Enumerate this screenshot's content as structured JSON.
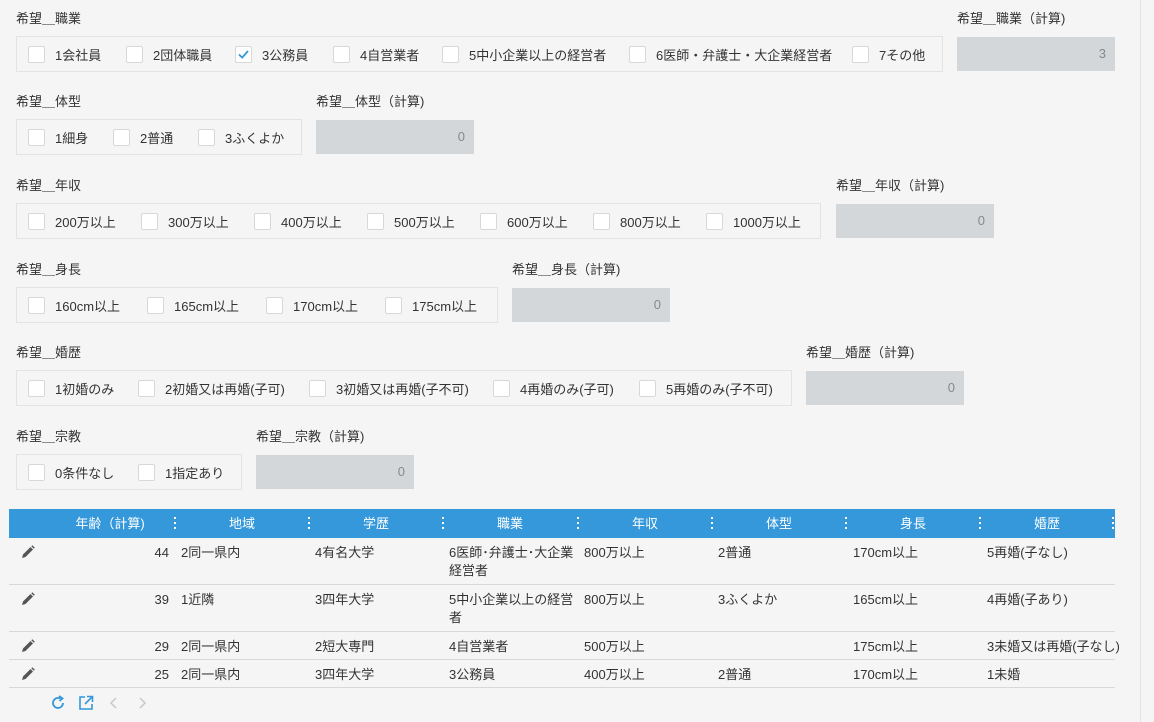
{
  "fields": {
    "occupation": {
      "label": "希望＿職業",
      "options": [
        {
          "label": "1会社員",
          "checked": false
        },
        {
          "label": "2団体職員",
          "checked": false
        },
        {
          "label": "3公務員",
          "checked": true
        },
        {
          "label": "4自営業者",
          "checked": false
        },
        {
          "label": "5中小企業以上の経営者",
          "checked": false
        },
        {
          "label": "6医師・弁護士・大企業経営者",
          "checked": false
        },
        {
          "label": "7その他",
          "checked": false
        }
      ],
      "calc_label": "希望＿職業（計算)",
      "calc_value": "3"
    },
    "body_type": {
      "label": "希望＿体型",
      "options": [
        {
          "label": "1細身",
          "checked": false
        },
        {
          "label": "2普通",
          "checked": false
        },
        {
          "label": "3ふくよか",
          "checked": false
        }
      ],
      "calc_label": "希望＿体型（計算)",
      "calc_value": "0"
    },
    "income": {
      "label": "希望＿年収",
      "options": [
        {
          "label": "200万以上",
          "checked": false
        },
        {
          "label": "300万以上",
          "checked": false
        },
        {
          "label": "400万以上",
          "checked": false
        },
        {
          "label": "500万以上",
          "checked": false
        },
        {
          "label": "600万以上",
          "checked": false
        },
        {
          "label": "800万以上",
          "checked": false
        },
        {
          "label": "1000万以上",
          "checked": false
        }
      ],
      "calc_label": "希望＿年収（計算)",
      "calc_value": "0"
    },
    "height": {
      "label": "希望＿身長",
      "options": [
        {
          "label": "160cm以上",
          "checked": false
        },
        {
          "label": "165cm以上",
          "checked": false
        },
        {
          "label": "170cm以上",
          "checked": false
        },
        {
          "label": "175cm以上",
          "checked": false
        }
      ],
      "calc_label": "希望＿身長（計算)",
      "calc_value": "0"
    },
    "marital": {
      "label": "希望＿婚歴",
      "options": [
        {
          "label": "1初婚のみ",
          "checked": false
        },
        {
          "label": "2初婚又は再婚(子可)",
          "checked": false
        },
        {
          "label": "3初婚又は再婚(子不可)",
          "checked": false
        },
        {
          "label": "4再婚のみ(子可)",
          "checked": false
        },
        {
          "label": "5再婚のみ(子不可)",
          "checked": false
        }
      ],
      "calc_label": "希望＿婚歴（計算)",
      "calc_value": "0"
    },
    "religion": {
      "label": "希望＿宗教",
      "options": [
        {
          "label": "0条件なし",
          "checked": false
        },
        {
          "label": "1指定あり",
          "checked": false
        }
      ],
      "calc_label": "希望＿宗教（計算)",
      "calc_value": "0"
    }
  },
  "table": {
    "columns": [
      "年齢（計算)",
      "地域",
      "学歴",
      "職業",
      "年収",
      "体型",
      "身長",
      "婚歴"
    ],
    "rows": [
      {
        "age": "44",
        "region": "2同一県内",
        "education": "4有名大学",
        "occupation": "6医師･弁護士･大企業経営者",
        "income": "800万以上",
        "body": "2普通",
        "height": "170cm以上",
        "marital": "5再婚(子なし)"
      },
      {
        "age": "39",
        "region": "1近隣",
        "education": "3四年大学",
        "occupation": "5中小企業以上の経営者",
        "income": "800万以上",
        "body": "3ふくよか",
        "height": "165cm以上",
        "marital": "4再婚(子あり)"
      },
      {
        "age": "29",
        "region": "2同一県内",
        "education": "2短大専門",
        "occupation": "4自営業者",
        "income": "500万以上",
        "body": "",
        "height": "175cm以上",
        "marital": "3未婚又は再婚(子なし)"
      },
      {
        "age": "25",
        "region": "2同一県内",
        "education": "3四年大学",
        "occupation": "3公務員",
        "income": "400万以上",
        "body": "2普通",
        "height": "170cm以上",
        "marital": "1未婚"
      }
    ]
  },
  "icons": {
    "edit": "pencil-icon",
    "refresh": "refresh-icon",
    "open": "open-external-icon",
    "prev": "chevron-left-icon",
    "next": "chevron-right-icon"
  },
  "colors": {
    "header_bg": "#3498db",
    "check_accent": "#3498db",
    "calc_bg": "#d4d7d9"
  }
}
